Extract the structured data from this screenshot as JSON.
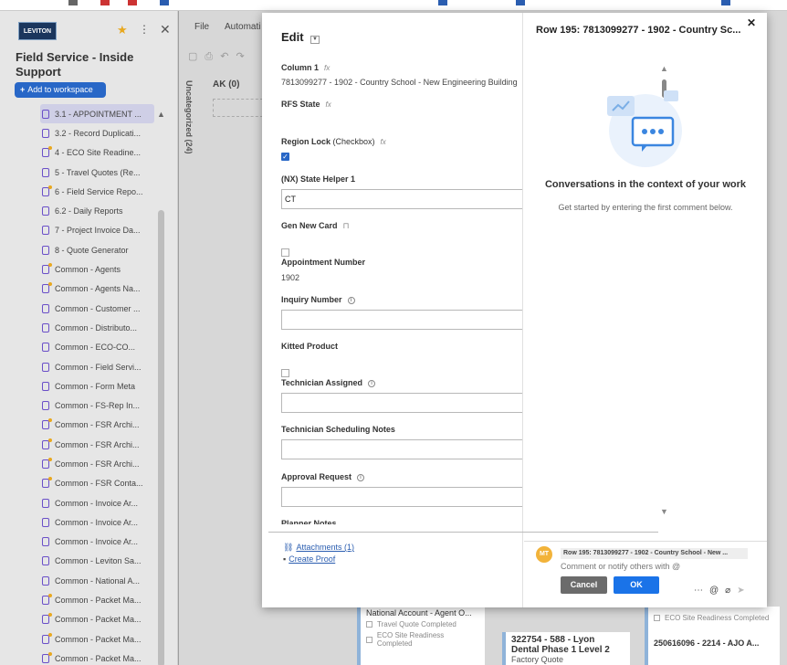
{
  "sidebar": {
    "logo": "LEVITON",
    "workspace_title": "Field Service - Inside Support",
    "add_workspace": "Add to workspace",
    "items": [
      {
        "label": "3.1 - APPOINTMENT ...",
        "starred": false
      },
      {
        "label": "3.2 - Record Duplicati...",
        "starred": false
      },
      {
        "label": "4 - ECO Site Readine...",
        "starred": true
      },
      {
        "label": "5 - Travel Quotes (Re...",
        "starred": false
      },
      {
        "label": "6 - Field Service Repo...",
        "starred": true
      },
      {
        "label": "6.2 - Daily Reports",
        "starred": false
      },
      {
        "label": "7 - Project Invoice Da...",
        "starred": false
      },
      {
        "label": "8 - Quote Generator",
        "starred": false
      },
      {
        "label": "Common - Agents",
        "starred": true
      },
      {
        "label": "Common - Agents Na...",
        "starred": true
      },
      {
        "label": "Common - Customer ...",
        "starred": false
      },
      {
        "label": "Common - Distributo...",
        "starred": false
      },
      {
        "label": "Common - ECO-CO...",
        "starred": false
      },
      {
        "label": "Common - Field Servi...",
        "starred": false
      },
      {
        "label": "Common - Form Meta",
        "starred": false
      },
      {
        "label": "Common - FS-Rep In...",
        "starred": false
      },
      {
        "label": "Common - FSR Archi...",
        "starred": true
      },
      {
        "label": "Common - FSR Archi...",
        "starred": true
      },
      {
        "label": "Common - FSR Archi...",
        "starred": true
      },
      {
        "label": "Common - FSR Conta...",
        "starred": true
      },
      {
        "label": "Common - Invoice Ar...",
        "starred": false
      },
      {
        "label": "Common - Invoice Ar...",
        "starred": false
      },
      {
        "label": "Common - Invoice Ar...",
        "starred": false
      },
      {
        "label": "Common - Leviton Sa...",
        "starred": false
      },
      {
        "label": "Common - National A...",
        "starred": false
      },
      {
        "label": "Common - Packet Ma...",
        "starred": true
      },
      {
        "label": "Common - Packet Ma...",
        "starred": true
      },
      {
        "label": "Common - Packet Ma...",
        "starred": true
      },
      {
        "label": "Common - Packet Ma...",
        "starred": true
      }
    ]
  },
  "app": {
    "menu_file": "File",
    "menu_automation": "Automati",
    "lane_label": "Uncategorized (24)",
    "column_ak": "AK (0)",
    "cards": {
      "national_title": "National Account - Agent O...",
      "national_chk1": "Travel Quote Completed",
      "national_chk2": "ECO Site Readiness Completed",
      "lyon_title": "322754 - 588 - Lyon Dental Phase 1 Level 2",
      "lyon_sub": "Factory Quote",
      "eco_chk": "ECO Site Readiness Completed",
      "ajo_title": "250616096 - 2214 - AJO A..."
    }
  },
  "modal": {
    "edit_title": "Edit",
    "fields": {
      "column1_label": "Column 1",
      "column1_value": "7813099277 - 1902 - Country School - New Engineering Building",
      "rfs_label": "RFS State",
      "region_lock_label": "Region Lock",
      "region_lock_type": "(Checkbox)",
      "nx_label": "(NX) State Helper 1",
      "nx_value": "CT",
      "gen_card_label": "Gen New Card",
      "appt_label": "Appointment Number",
      "appt_value": "1902",
      "inquiry_label": "Inquiry Number",
      "kitted_label": "Kitted Product",
      "tech_label": "Technician Assigned",
      "tech_notes_label": "Technician Scheduling Notes",
      "approval_label": "Approval Request",
      "planner_label": "Planner Notes"
    },
    "attachments": "Attachments (1)",
    "create_proof": "Create Proof",
    "conversation": {
      "row_title": "Row 195: 7813099277 - 1902 - Country Sc...",
      "heading": "Conversations in the context of your work",
      "subheading": "Get started by entering the first comment below.",
      "avatar_initials": "MT",
      "row_chip": "Row 195: 7813099277 - 1902 - Country School - New ...",
      "comment_placeholder": "Comment or notify others with @",
      "cancel": "Cancel",
      "ok": "OK"
    }
  },
  "colors": {
    "accent": "#1a73e8",
    "add_workspace": "#2867c7",
    "sheet_icon": "#6a4fc8",
    "star": "#e8a81f",
    "avatar": "#f2b33a"
  }
}
